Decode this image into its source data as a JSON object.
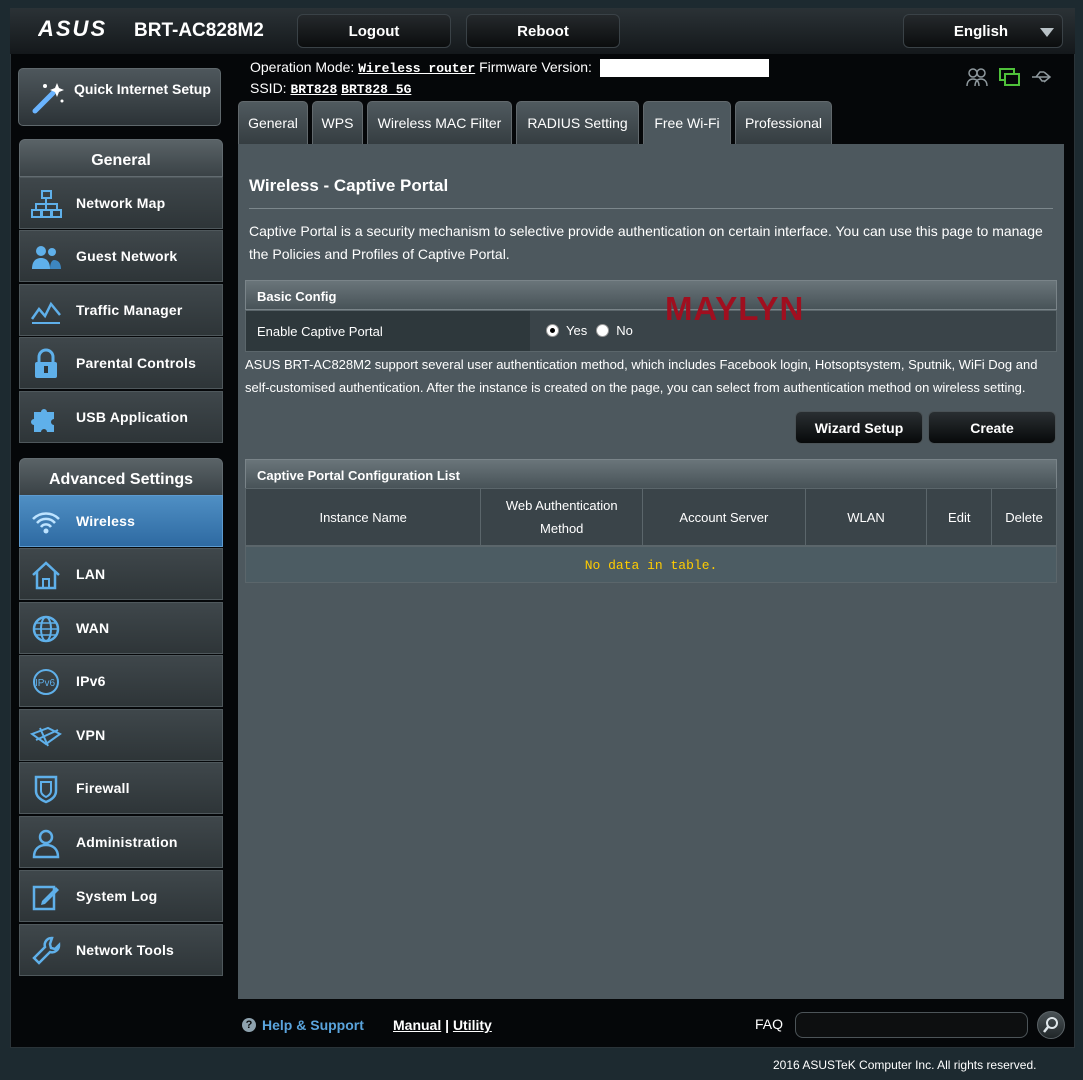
{
  "header": {
    "brand": "ASUS",
    "model": "BRT-AC828M2",
    "logout_label": "Logout",
    "reboot_label": "Reboot",
    "language": "English"
  },
  "info": {
    "operation_mode_label": "Operation Mode:",
    "operation_mode_value": "Wireless router",
    "firmware_label": "Firmware Version:",
    "ssid_label": "SSID:",
    "ssid_1": "BRT828",
    "ssid_2": "BRT828_5G"
  },
  "sidebar": {
    "quick_setup_label": "Quick Internet Setup",
    "general_header": "General",
    "general_items": [
      {
        "label": "Network Map",
        "icon": "network-map-icon"
      },
      {
        "label": "Guest Network",
        "icon": "guest-network-icon"
      },
      {
        "label": "Traffic Manager",
        "icon": "traffic-manager-icon"
      },
      {
        "label": "Parental Controls",
        "icon": "parental-controls-icon"
      },
      {
        "label": "USB Application",
        "icon": "usb-application-icon"
      }
    ],
    "advanced_header": "Advanced Settings",
    "advanced_items": [
      {
        "label": "Wireless",
        "icon": "wireless-icon",
        "active": true
      },
      {
        "label": "LAN",
        "icon": "lan-icon"
      },
      {
        "label": "WAN",
        "icon": "wan-icon"
      },
      {
        "label": "IPv6",
        "icon": "ipv6-icon"
      },
      {
        "label": "VPN",
        "icon": "vpn-icon"
      },
      {
        "label": "Firewall",
        "icon": "firewall-icon"
      },
      {
        "label": "Administration",
        "icon": "administration-icon"
      },
      {
        "label": "System Log",
        "icon": "system-log-icon"
      },
      {
        "label": "Network Tools",
        "icon": "network-tools-icon"
      }
    ]
  },
  "tabs": [
    {
      "label": "General"
    },
    {
      "label": "WPS"
    },
    {
      "label": "Wireless MAC Filter"
    },
    {
      "label": "RADIUS Setting"
    },
    {
      "label": "Free Wi-Fi",
      "active": true
    },
    {
      "label": "Professional"
    }
  ],
  "main": {
    "title": "Wireless - Captive Portal",
    "description": "Captive Portal is a security mechanism to selective provide authentication on certain interface. You can use this page to manage the Policies and Profiles of Captive Portal.",
    "basic_config_header": "Basic Config",
    "enable_label": "Enable Captive Portal",
    "yes_label": "Yes",
    "no_label": "No",
    "enable_value": "Yes",
    "watermark": "MAYLYN",
    "note": "ASUS BRT-AC828M2 support several user authentication method, which includes Facebook login, Hotsoptsystem, Sputnik, WiFi Dog and self-customised authentication. After the instance is created on the page, you can select from authentication method on wireless setting.",
    "wizard_label": "Wizard Setup",
    "create_label": "Create",
    "list_header": "Captive Portal Configuration List",
    "columns": [
      "Instance Name",
      "Web Authentication Method",
      "Account Server",
      "WLAN",
      "Edit",
      "Delete"
    ],
    "no_data": "No data in table."
  },
  "footer": {
    "help_label": "Help & Support",
    "manual_label": "Manual",
    "separator": "|",
    "utility_label": "Utility",
    "faq_label": "FAQ",
    "copyright": "2016 ASUSTeK Computer Inc. All rights reserved."
  },
  "colors": {
    "accent_blue": "#3a78b4",
    "warning_text": "#ffcc00",
    "watermark": "#a00f1f"
  }
}
